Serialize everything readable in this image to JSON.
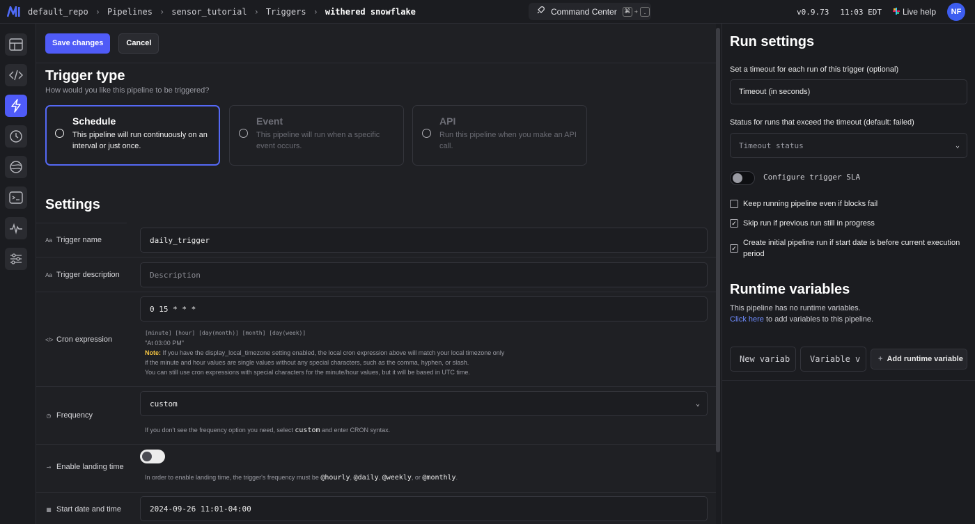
{
  "header": {
    "breadcrumbs": [
      "default_repo",
      "Pipelines",
      "sensor_tutorial",
      "Triggers"
    ],
    "current": "withered snowflake",
    "command_center": "Command Center",
    "kbd1": "⌘",
    "kbd_plus": "+",
    "kbd2": ".",
    "version": "v0.9.73",
    "time": "11:03 EDT",
    "live_help": "Live help",
    "avatar": "NF"
  },
  "toolbar": {
    "save": "Save changes",
    "cancel": "Cancel"
  },
  "trigger_type": {
    "title": "Trigger type",
    "subtitle": "How would you like this pipeline to be triggered?",
    "options": [
      {
        "title": "Schedule",
        "desc": "This pipeline will run continuously on an interval or just once.",
        "selected": true
      },
      {
        "title": "Event",
        "desc": "This pipeline will run when a specific event occurs.",
        "selected": false
      },
      {
        "title": "API",
        "desc": "Run this pipeline when you make an API call.",
        "selected": false
      }
    ]
  },
  "settings": {
    "title": "Settings",
    "trigger_name_label": "Trigger name",
    "trigger_name_value": "daily_trigger",
    "trigger_desc_label": "Trigger description",
    "trigger_desc_placeholder": "Description",
    "cron_label": "Cron expression",
    "cron_value": "0 15 * * *",
    "cron_format": "[minute] [hour] [day(month)] [month] [day(week)]",
    "cron_human": "\"At 03:00 PM\"",
    "note_label": "Note:",
    "note_line1": "If you have the display_local_timezone setting enabled, the local cron expression above will match your local timezone only",
    "note_line2": "if the minute and hour values are single values without any special characters, such as the comma, hyphen, or slash.",
    "note_line3": "You can still use cron expressions with special characters for the minute/hour values, but it will be based in UTC time.",
    "frequency_label": "Frequency",
    "frequency_value": "custom",
    "frequency_help_pre": "If you don't see the frequency option you need, select",
    "frequency_help_code": "custom",
    "frequency_help_post": "and enter CRON syntax.",
    "landing_label": "Enable landing time",
    "landing_help_pre": "In order to enable landing time, the trigger's frequency must be",
    "landing_opts": [
      "@hourly",
      "@daily",
      "@weekly",
      "@monthly"
    ],
    "landing_or": "or",
    "start_label": "Start date and time",
    "start_value": "2024-09-26 11:01-04:00"
  },
  "run_settings": {
    "title": "Run settings",
    "timeout_label": "Set a timeout for each run of this trigger (optional)",
    "timeout_placeholder": "Timeout (in seconds)",
    "status_label": "Status for runs that exceed the timeout (default: failed)",
    "status_placeholder": "Timeout status",
    "sla_label": "Configure trigger SLA",
    "cb1": "Keep running pipeline even if blocks fail",
    "cb2": "Skip run if previous run still in progress",
    "cb3": "Create initial pipeline run if start date is before current execution period"
  },
  "runtime_vars": {
    "title": "Runtime variables",
    "empty_text": "This pipeline has no runtime variables.",
    "link": "Click here",
    "link_tail": "to add variables to this pipeline.",
    "new_var_placeholder": "New variab",
    "variable_value": "Variable v",
    "add_button": "Add runtime variable"
  },
  "colors": {
    "accent": "#4f5bf7",
    "background": "#1f2024",
    "note": "#f5c542",
    "link": "#6f8cff"
  }
}
